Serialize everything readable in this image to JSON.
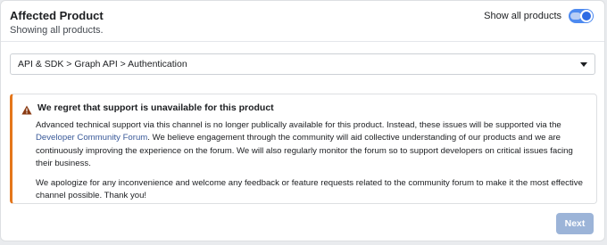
{
  "header": {
    "title": "Affected Product",
    "subtitle": "Showing all products."
  },
  "toggle": {
    "label": "Show all products",
    "state": "on",
    "accent_color": "#2d6be4"
  },
  "product_select": {
    "value": "API & SDK > Graph API > Authentication",
    "icon": "caret-down-icon"
  },
  "notice": {
    "icon": "warning-icon",
    "accent_color": "#e4761b",
    "title": "We regret that support is unavailable for this product",
    "p1_before_link": "Advanced technical support via this channel is no longer publically available for this product. Instead, these issues will be supported via the ",
    "p1_link": "Developer Community Forum",
    "p1_after_link": ". We believe engagement through the community will aid collective understanding of our products and we are continuously improving the experience on the forum. We will also regularly monitor the forum so to support developers on critical issues facing their business.",
    "p2": "We apologize for any inconvenience and welcome any feedback or feature requests related to the community forum to make it the most effective channel possible. Thank you!"
  },
  "footer": {
    "next_label": "Next",
    "next_color": "#9cb4d8"
  }
}
